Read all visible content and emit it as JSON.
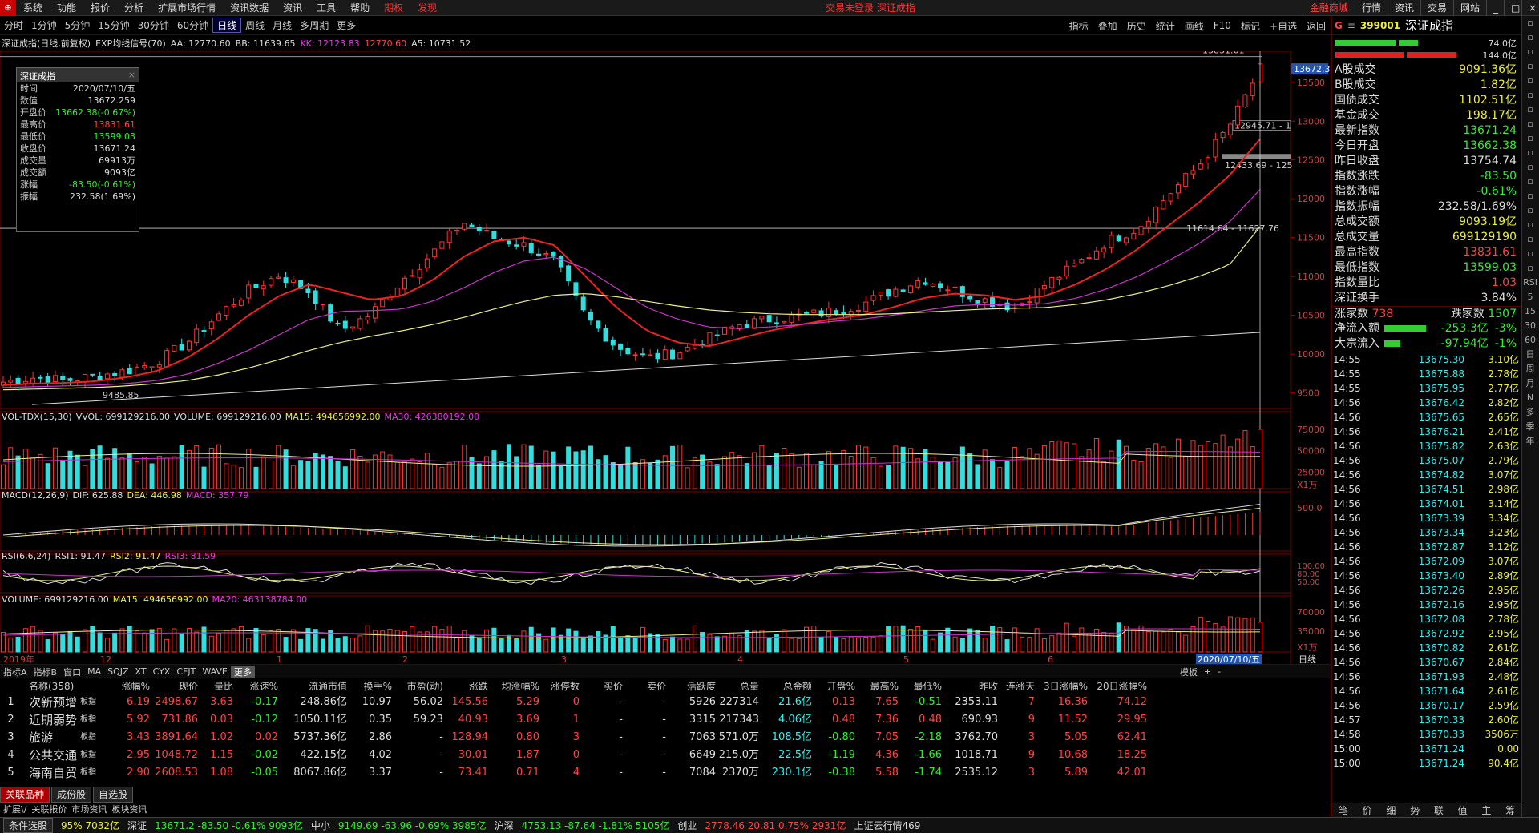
{
  "menubar": {
    "items": [
      "系统",
      "功能",
      "报价",
      "分析",
      "扩展市场行情",
      "资讯数据",
      "资讯",
      "工具",
      "帮助"
    ],
    "special": [
      "期权",
      "发现"
    ],
    "center_text": "交易未登录  深证成指",
    "right_buttons": [
      "金融商城",
      "行情",
      "资讯",
      "交易",
      "网站"
    ]
  },
  "toolbar": {
    "periods": [
      "分时",
      "1分钟",
      "5分钟",
      "15分钟",
      "30分钟",
      "60分钟",
      "日线",
      "周线",
      "月线",
      "多周期",
      "更多"
    ],
    "active": "日线",
    "right": [
      "指标",
      "叠加",
      "历史",
      "统计",
      "画线",
      "F10",
      "标记",
      "+自选",
      "返回"
    ]
  },
  "chart_header": {
    "name": "深证成指(日线,前复权)",
    "indicator": "EXP均线信号(70)",
    "aa": "AA: 12770.60",
    "bb": "BB: 11639.65",
    "kk": "KK: 12123.83",
    "v4": "12770.60",
    "a5": "A5: 10731.52"
  },
  "info_box": {
    "title": "深证成指",
    "rows": [
      {
        "k": "时间",
        "v": "2020/07/10/五"
      },
      {
        "k": "数值",
        "v": "13672.259"
      },
      {
        "k": "开盘价",
        "v": "13662.38(-0.67%)"
      },
      {
        "k": "最高价",
        "v": "13831.61"
      },
      {
        "k": "最低价",
        "v": "13599.03"
      },
      {
        "k": "收盘价",
        "v": "13671.24"
      },
      {
        "k": "成交量",
        "v": "69913万"
      },
      {
        "k": "成交额",
        "v": "9093亿"
      },
      {
        "k": "涨幅",
        "v": "-83.50(-0.61%)"
      },
      {
        "k": "振幅",
        "v": "232.58(1.69%)"
      }
    ]
  },
  "price_axis": [
    "13500",
    "13000",
    "12500",
    "12000",
    "11500",
    "11000",
    "10500",
    "10000",
    "9500"
  ],
  "price_label_current": "13672.3",
  "chart_annotations": {
    "high": "13831.61",
    "low": "9485.85",
    "range1": "12945.71 - 1",
    "range2": "12433.69 - 125",
    "range3": "11614.64 - 11627.76"
  },
  "chart_data": {
    "type": "line",
    "title": "深证成指(日线,前复权)",
    "x_labels": [
      "2019年",
      "12",
      "1",
      "2",
      "3",
      "4",
      "5",
      "6",
      "2020/07/10/五"
    ],
    "series": [
      {
        "name": "close",
        "values": [
          9640,
          9700,
          9660,
          9720,
          9780,
          9900,
          10150,
          10500,
          10820,
          11020,
          10800,
          10300,
          10520,
          10950,
          11300,
          11700,
          11500,
          11400,
          11200,
          10480,
          10100,
          9950,
          10020,
          10200,
          10380,
          10450,
          10490,
          10550,
          10640,
          10820,
          10970,
          10830,
          10700,
          10600,
          10900,
          11150,
          11450,
          11620,
          12050,
          12430,
          12940,
          13671
        ]
      },
      {
        "name": "MA",
        "values": [
          9600,
          9620,
          9630,
          9650,
          9700,
          9780,
          9950,
          10200,
          10500,
          10750,
          10900,
          10800,
          10700,
          10750,
          10950,
          11250,
          11450,
          11500,
          11400,
          11000,
          10600,
          10300,
          10150,
          10100,
          10200,
          10300,
          10380,
          10450,
          10500,
          10600,
          10720,
          10780,
          10760,
          10700,
          10750,
          10900,
          11100,
          11350,
          11650,
          11950,
          12300,
          12770
        ]
      },
      {
        "name": "MA2",
        "values": [
          9570,
          9580,
          9590,
          9600,
          9620,
          9660,
          9740,
          9880,
          10050,
          10250,
          10450,
          10550,
          10560,
          10580,
          10680,
          10850,
          11050,
          11200,
          11250,
          11100,
          10850,
          10600,
          10450,
          10350,
          10330,
          10350,
          10380,
          10420,
          10450,
          10500,
          10560,
          10620,
          10640,
          10630,
          10650,
          10720,
          10840,
          11000,
          11200,
          11420,
          11700,
          12120
        ]
      },
      {
        "name": "MA3",
        "values": [
          9540,
          9550,
          9560,
          9570,
          9590,
          9620,
          9660,
          9730,
          9820,
          9930,
          10050,
          10150,
          10230,
          10300,
          10380,
          10470,
          10580,
          10680,
          10760,
          10780,
          10740,
          10680,
          10620,
          10570,
          10540,
          10520,
          10510,
          10510,
          10510,
          10520,
          10540,
          10560,
          10580,
          10590,
          10600,
          10640,
          10700,
          10780,
          10880,
          11000,
          11150,
          11640
        ]
      }
    ],
    "volume_axis": [
      "75000",
      "50000",
      "25000"
    ],
    "volume_unit": "X1万",
    "vol_header": {
      "name": "VOL-TDX(15,30)",
      "vvol": "VVOL: 699129216.00",
      "volume": "VOLUME: 699129216.00",
      "ma15": "MA15: 494656992.00",
      "ma30": "MA30: 426380192.00"
    },
    "macd_header": {
      "name": "MACD(12,26,9)",
      "dif": "DIF: 625.88",
      "dea": "DEA: 446.98",
      "macd": "MACD: 357.79"
    },
    "macd_axis": [
      "500.0"
    ],
    "rsi_header": {
      "name": "RSI(6,6,24)",
      "rsi1": "RSI1: 91.47",
      "rsi2": "RSI2: 91.47",
      "rsi3": "RSI3: 81.59"
    },
    "rsi_axis": [
      "100.00",
      "80.00",
      "50.00"
    ],
    "vol2_header": {
      "volume": "VOLUME: 699129216.00",
      "ma15": "MA15: 494656992.00",
      "ma20": "MA20: 463138784.00"
    },
    "vol2_axis": [
      "70000",
      "35000"
    ],
    "vol2_unit": "X1万",
    "period_label": "日线"
  },
  "right_panel": {
    "code": "399001",
    "name": "深证成指",
    "bar_vals": [
      "74.0亿",
      "144.0亿"
    ],
    "stats": [
      {
        "k": "A股成交",
        "v": "9091.36亿",
        "c": "#ee3"
      },
      {
        "k": "B股成交",
        "v": "1.82亿",
        "c": "#ee3"
      },
      {
        "k": "国债成交",
        "v": "1102.51亿",
        "c": "#ee3"
      },
      {
        "k": "基金成交",
        "v": "198.17亿",
        "c": "#ee3"
      },
      {
        "k": "最新指数",
        "v": "13671.24",
        "c": "#3e3"
      },
      {
        "k": "今日开盘",
        "v": "13662.38",
        "c": "#3e3"
      },
      {
        "k": "昨日收盘",
        "v": "13754.74",
        "c": "#ddd"
      },
      {
        "k": "指数涨跌",
        "v": "-83.50",
        "c": "#3e3"
      },
      {
        "k": "指数涨幅",
        "v": "-0.61%",
        "c": "#3e3"
      },
      {
        "k": "指数振幅",
        "v": "232.58/1.69%",
        "c": "#ddd"
      },
      {
        "k": "总成交额",
        "v": "9093.19亿",
        "c": "#ee3"
      },
      {
        "k": "总成交量",
        "v": "699129190",
        "c": "#ee3"
      },
      {
        "k": "最高指数",
        "v": "13831.61",
        "c": "#f44"
      },
      {
        "k": "最低指数",
        "v": "13599.03",
        "c": "#3e3"
      },
      {
        "k": "指数量比",
        "v": "1.03",
        "c": "#f44"
      },
      {
        "k": "深证换手",
        "v": "3.84%",
        "c": "#ddd"
      }
    ],
    "rise_label": "涨家数",
    "rise": "738",
    "fall_label": "跌家数",
    "fall": "1507",
    "flows": [
      {
        "k": "净流入额",
        "v": "-253.3亿",
        "p": "-3%"
      },
      {
        "k": "大宗流入",
        "v": "-97.94亿",
        "p": "-1%"
      }
    ],
    "ticks": [
      [
        "14:55",
        "13675.30",
        "3.10亿"
      ],
      [
        "14:55",
        "13675.88",
        "2.78亿"
      ],
      [
        "14:55",
        "13675.95",
        "2.77亿"
      ],
      [
        "14:56",
        "13676.42",
        "2.82亿"
      ],
      [
        "14:56",
        "13675.65",
        "2.65亿"
      ],
      [
        "14:56",
        "13676.21",
        "2.41亿"
      ],
      [
        "14:56",
        "13675.82",
        "2.63亿"
      ],
      [
        "14:56",
        "13675.07",
        "2.79亿"
      ],
      [
        "14:56",
        "13674.82",
        "3.07亿"
      ],
      [
        "14:56",
        "13674.51",
        "2.98亿"
      ],
      [
        "14:56",
        "13674.01",
        "3.14亿"
      ],
      [
        "14:56",
        "13673.39",
        "3.34亿"
      ],
      [
        "14:56",
        "13673.34",
        "3.23亿"
      ],
      [
        "14:56",
        "13672.87",
        "3.12亿"
      ],
      [
        "14:56",
        "13672.09",
        "3.07亿"
      ],
      [
        "14:56",
        "13673.40",
        "2.89亿"
      ],
      [
        "14:56",
        "13672.26",
        "2.95亿"
      ],
      [
        "14:56",
        "13672.16",
        "2.95亿"
      ],
      [
        "14:56",
        "13672.08",
        "2.78亿"
      ],
      [
        "14:56",
        "13672.92",
        "2.95亿"
      ],
      [
        "14:56",
        "13670.82",
        "2.61亿"
      ],
      [
        "14:56",
        "13670.67",
        "2.84亿"
      ],
      [
        "14:56",
        "13671.93",
        "2.48亿"
      ],
      [
        "14:56",
        "13671.64",
        "2.61亿"
      ],
      [
        "14:56",
        "13670.17",
        "2.59亿"
      ],
      [
        "14:57",
        "13670.33",
        "2.60亿"
      ],
      [
        "14:58",
        "13670.33",
        "3506万"
      ],
      [
        "15:00",
        "13671.24",
        "0.00"
      ],
      [
        "15:00",
        "13671.24",
        "90.4亿"
      ]
    ],
    "bottom_tabs": [
      "笔",
      "价",
      "细",
      "势",
      "联",
      "值",
      "主",
      "筹"
    ]
  },
  "side_icons": [
    "RSI",
    "5",
    "15",
    "30",
    "60",
    "日",
    "周",
    "月",
    "N",
    "多",
    "季",
    "年"
  ],
  "tabs_bar": [
    "指标A",
    "指标B",
    "窗口",
    "MA",
    "SQJZ",
    "XT",
    "CYX",
    "CFJT",
    "WAVE",
    "更多",
    "模板",
    "+",
    "-"
  ],
  "table": {
    "headers": [
      "",
      "名称(358)",
      "涨幅%",
      "现价",
      "量比",
      "涨速%",
      "流通市值",
      "换手%",
      "市盈(动)",
      "涨跌",
      "均涨幅%",
      "涨停数",
      "买价",
      "卖价",
      "活跃度",
      "总量",
      "总金额",
      "开盘%",
      "最高%",
      "最低%",
      "昨收",
      "连涨天",
      "3日涨幅%",
      "20日涨幅%"
    ],
    "rows": [
      [
        "1",
        "次新预增",
        "6.19",
        "2498.67",
        "3.63",
        "-0.17",
        "248.86亿",
        "10.97",
        "56.02",
        "145.56",
        "5.29",
        "0",
        "-",
        "-",
        "5926",
        "227314",
        "21.6亿",
        "0.13",
        "7.65",
        "-0.51",
        "2353.11",
        "7",
        "16.36",
        "74.12"
      ],
      [
        "2",
        "近期弱势",
        "5.92",
        "731.86",
        "0.03",
        "-0.12",
        "1050.11亿",
        "0.35",
        "59.23",
        "40.93",
        "3.69",
        "1",
        "-",
        "-",
        "3315",
        "217343",
        "4.06亿",
        "0.48",
        "7.36",
        "0.48",
        "690.93",
        "9",
        "11.52",
        "29.95"
      ],
      [
        "3",
        "旅游",
        "3.43",
        "3891.64",
        "1.02",
        "0.02",
        "5737.36亿",
        "2.86",
        "-",
        "128.94",
        "0.80",
        "3",
        "-",
        "-",
        "7063",
        "571.0万",
        "108.5亿",
        "-0.80",
        "7.05",
        "-2.18",
        "3762.70",
        "3",
        "5.05",
        "62.41"
      ],
      [
        "4",
        "公共交通",
        "2.95",
        "1048.72",
        "1.15",
        "-0.02",
        "422.15亿",
        "4.02",
        "-",
        "30.01",
        "1.87",
        "0",
        "-",
        "-",
        "6649",
        "215.0万",
        "22.5亿",
        "-1.19",
        "4.36",
        "-1.66",
        "1018.71",
        "9",
        "10.68",
        "18.25"
      ],
      [
        "5",
        "海南自贸",
        "2.90",
        "2608.53",
        "1.08",
        "-0.05",
        "8067.86亿",
        "3.37",
        "-",
        "73.41",
        "0.71",
        "4",
        "-",
        "-",
        "7084",
        "2370万",
        "230.1亿",
        "-0.38",
        "5.58",
        "-1.74",
        "2535.12",
        "3",
        "5.89",
        "42.01"
      ]
    ],
    "tag": "板指"
  },
  "bottom_tabs": [
    "关联品种",
    "成份股",
    "自选股"
  ],
  "sub_tabs": [
    "扩展\\/",
    "关联报价",
    "市场资讯",
    "板块资讯"
  ],
  "left_label": "条件选股",
  "status": [
    {
      "t": "95% 7032亿",
      "c": "#ee3"
    },
    {
      "t": "深证",
      "c": "#ddd"
    },
    {
      "t": "13671.2 -83.50 -0.61% 9093亿",
      "c": "#3e3"
    },
    {
      "t": "中小",
      "c": "#ddd"
    },
    {
      "t": "9149.69 -63.96 -0.69% 3985亿",
      "c": "#3e3"
    },
    {
      "t": "沪深",
      "c": "#ddd"
    },
    {
      "t": "4753.13 -87.64 -1.81% 5105亿",
      "c": "#3e3"
    },
    {
      "t": "创业",
      "c": "#ddd"
    },
    {
      "t": "2778.46 20.81 0.75% 2931亿",
      "c": "#f44"
    },
    {
      "t": "上证云行情469",
      "c": "#ddd"
    }
  ]
}
